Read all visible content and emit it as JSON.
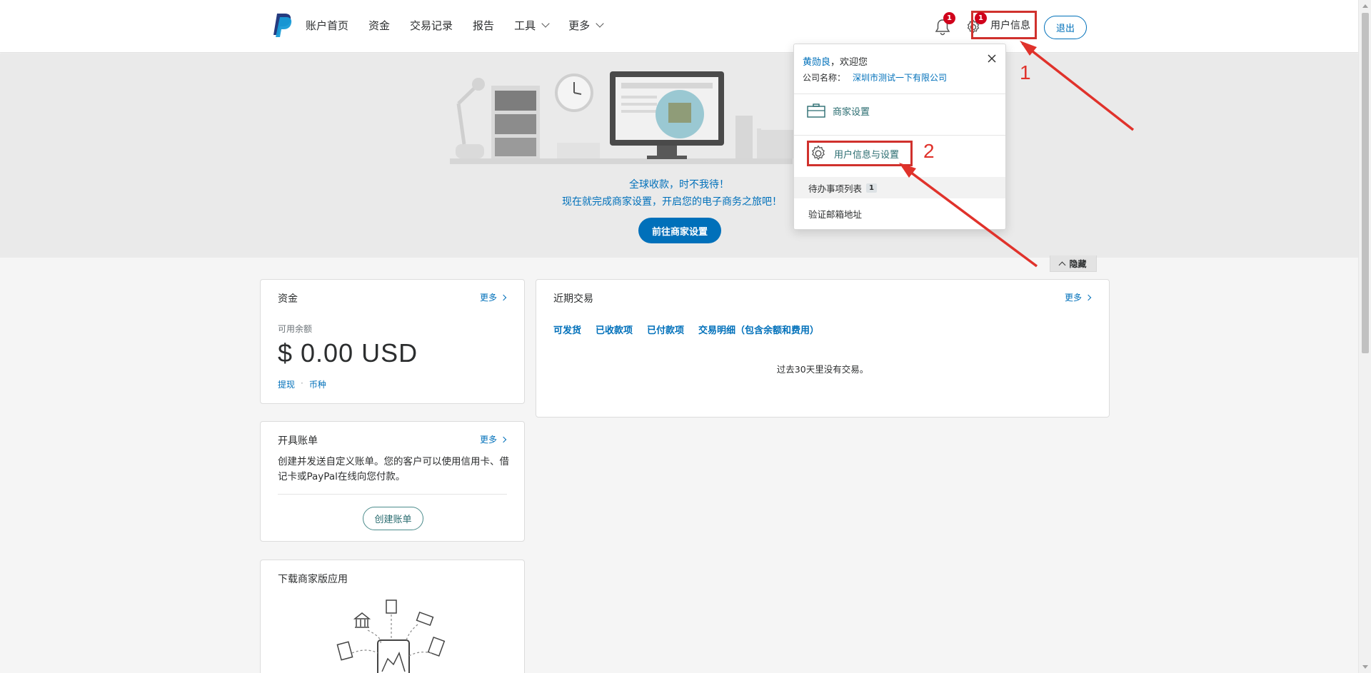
{
  "header": {
    "nav": [
      {
        "label": "账户首页"
      },
      {
        "label": "资金"
      },
      {
        "label": "交易记录"
      },
      {
        "label": "报告"
      },
      {
        "label": "工具",
        "has_dropdown": true
      },
      {
        "label": "更多",
        "has_dropdown": true
      }
    ],
    "notification_count": "1",
    "settings_count": "1",
    "user_info_label": "用户信息",
    "logout_label": "退出"
  },
  "hero": {
    "line1": "全球收款，时不我待！",
    "line2": "现在就完成商家设置，开启您的电子商务之旅吧！",
    "button_label": "前往商家设置",
    "hide_label": "隐藏"
  },
  "funds_card": {
    "title": "资金",
    "more_label": "更多",
    "balance_label": "可用余额",
    "balance": "$ 0.00 USD",
    "link_withdraw": "提现",
    "link_separator": "·",
    "link_currency": "币种"
  },
  "invoice_card": {
    "title": "开具账单",
    "more_label": "更多",
    "description": "创建并发送自定义账单。您的客户可以使用信用卡、借记卡或PayPal在线向您付款。",
    "button_label": "创建账单"
  },
  "app_card": {
    "title": "下载商家版应用"
  },
  "transactions_card": {
    "title": "近期交易",
    "more_label": "更多",
    "tabs": [
      "可发货",
      "已收款项",
      "已付款项",
      "交易明细（包含余额和费用）"
    ],
    "empty_text": "过去30天里没有交易。"
  },
  "dropdown": {
    "user_name": "黄勋良",
    "greeting_suffix": "，欢迎您",
    "company_label": "公司名称：",
    "company_value": "深圳市测试一下有限公司",
    "merchant_settings": "商家设置",
    "user_settings": "用户信息与设置",
    "todo_label": "待办事项列表",
    "todo_count": "1",
    "verify_email": "验证邮箱地址"
  },
  "annotations": {
    "step1": "1",
    "step2": "2",
    "color": "#e0322b"
  },
  "colors": {
    "brand_blue": "#0070ba",
    "alert_red": "#d0021b",
    "teal_link": "#2a6c70"
  }
}
